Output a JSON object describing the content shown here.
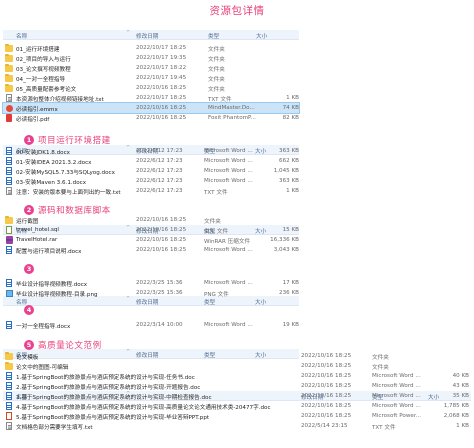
{
  "page_title": "资源包详情",
  "columns": {
    "name": "名称",
    "date": "修改日期",
    "type": "类型",
    "size": "大小",
    "sort_icon": "^"
  },
  "sections": [
    {
      "rows": [
        {
          "icon": "folder",
          "name": "01_运行环境搭建",
          "date": "2022/10/17 18:25",
          "type": "文件夹",
          "size": ""
        },
        {
          "icon": "folder",
          "name": "02_项目的导入与运行",
          "date": "2022/10/17 19:35",
          "type": "文件夹",
          "size": ""
        },
        {
          "icon": "folder",
          "name": "03_论文撰写视频教程",
          "date": "2022/10/17 18:22",
          "type": "文件夹",
          "size": ""
        },
        {
          "icon": "folder",
          "name": "04_一对一全程指导",
          "date": "2022/10/17 19:45",
          "type": "文件夹",
          "size": ""
        },
        {
          "icon": "folder",
          "name": "05_高质量配套参考论文",
          "date": "2022/10/16 18:25",
          "type": "文件夹",
          "size": ""
        },
        {
          "icon": "txt",
          "name": "本资源包整体介绍视频链接地址.txt",
          "date": "2022/10/17 18:25",
          "type": "TXT 文件",
          "size": "1 KB"
        },
        {
          "icon": "emmx",
          "name": "必读指引.emmx",
          "date": "2022/10/16 18:25",
          "type": "MindMaster.Do...",
          "size": "74 KB",
          "selected": true
        },
        {
          "icon": "pdf",
          "name": "必读指引.pdf",
          "date": "2022/10/16 18:25",
          "type": "Foxit PhantomP...",
          "size": "82 KB"
        }
      ]
    },
    {
      "badge": "1",
      "label": "项目运行环境搭建",
      "rows": [
        {
          "icon": "doc",
          "name": "00-安装JDK1.8.docx",
          "date": "2022/6/12 17:23",
          "type": "Microsoft Word ...",
          "size": "363 KB"
        },
        {
          "icon": "doc",
          "name": "01-安装IDEA 2021.3.2.docx",
          "date": "2022/6/12 17:23",
          "type": "Microsoft Word ...",
          "size": "662 KB"
        },
        {
          "icon": "doc",
          "name": "02-安装MySQL5.7.33与SQLyog.docx",
          "date": "2022/6/12 17:23",
          "type": "Microsoft Word ...",
          "size": "1,045 KB"
        },
        {
          "icon": "doc",
          "name": "03-安装Maven 3.6.1.docx",
          "date": "2022/6/12 17:23",
          "type": "Microsoft Word ...",
          "size": "363 KB"
        },
        {
          "icon": "txt",
          "name": "注意：安装的版本要与上面列出的一致.txt",
          "date": "2022/6/12 17:23",
          "type": "TXT 文件",
          "size": "1 KB"
        }
      ]
    },
    {
      "badge": "2",
      "label": "源码和数据库脚本",
      "rows": [
        {
          "icon": "folder",
          "name": "运行截图",
          "date": "2022/10/16 18:25",
          "type": "文件夹",
          "size": ""
        },
        {
          "icon": "sql",
          "name": "travel_hotel.sql",
          "date": "2022/10/16 18:25",
          "type": "SQL 文件",
          "size": "15 KB"
        },
        {
          "icon": "rar",
          "name": "TravelHotel.rar",
          "date": "2022/10/16 18:25",
          "type": "WinRAR 压缩文件",
          "size": "16,336 KB"
        },
        {
          "icon": "doc",
          "name": "配置与运行项目说明.docx",
          "date": "2022/10/16 18:25",
          "type": "Microsoft Word ...",
          "size": "3,043 KB"
        }
      ]
    },
    {
      "badge": "3",
      "label": "",
      "rows": [
        {
          "icon": "doc",
          "name": "毕业设计指导视频教程.docx",
          "date": "2022/3/25 15:36",
          "type": "Microsoft Word ...",
          "size": "17 KB"
        },
        {
          "icon": "png",
          "name": "毕业设计指导视频教程-目录.png",
          "date": "2022/3/25 15:36",
          "type": "PNG 文件",
          "size": "236 KB"
        }
      ]
    },
    {
      "badge": "4",
      "label": "",
      "rows": [
        {
          "icon": "doc",
          "name": "一对一全程指导.docx",
          "date": "2022/3/14 10:00",
          "type": "Microsoft Word ...",
          "size": "19 KB"
        }
      ]
    },
    {
      "badge": "5",
      "label": "高质量论文范例",
      "rows": [
        {
          "icon": "folder",
          "name": "论文模板",
          "date": "2022/10/16 18:25",
          "type": "文件夹",
          "size": ""
        },
        {
          "icon": "folder",
          "name": "论文中的图图-可编辑",
          "date": "2022/10/16 18:25",
          "type": "文件夹",
          "size": ""
        },
        {
          "icon": "doc",
          "name": "1.基于SpringBoot的旅游景点与酒店预定系统的设计与实现-任务书.doc",
          "date": "2022/10/16 18:25",
          "type": "Microsoft Word ...",
          "size": "40 KB"
        },
        {
          "icon": "doc",
          "name": "2.基于SpringBoot的旅游景点与酒店预定系统的设计与实现-开题报告.doc",
          "date": "2022/10/16 18:25",
          "type": "Microsoft Word ...",
          "size": "43 KB"
        },
        {
          "icon": "doc",
          "name": "3.基于SpringBoot的旅游景点与酒店预定系统的设计与实现-中期检查报告.doc",
          "date": "2022/10/16 18:25",
          "type": "Microsoft Word ...",
          "size": "35 KB"
        },
        {
          "icon": "doc",
          "name": "4.基于SpringBoot的旅游景点与酒店预定系统的设计与实现-高质量论文论文通用技术类-20477字.doc",
          "date": "2022/10/16 18:25",
          "type": "Microsoft Word ...",
          "size": "1,785 KB"
        },
        {
          "icon": "ppt",
          "name": "5.基于SpringBoot的旅游景点与酒店预定系统的设计与实现-毕业答辩PPT.ppt",
          "date": "2022/10/16 18:25",
          "type": "Microsoft Power...",
          "size": "2,068 KB"
        },
        {
          "icon": "txt",
          "name": "文档格色部分需要学生填写.txt",
          "date": "2022/5/14 23:15",
          "type": "TXT 文件",
          "size": "1 KB"
        }
      ]
    }
  ]
}
